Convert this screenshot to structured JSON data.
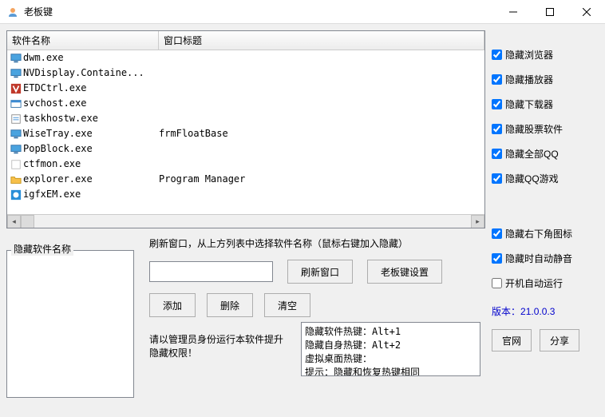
{
  "window": {
    "title": "老板键"
  },
  "table": {
    "headers": {
      "name": "软件名称",
      "title": "窗口标题"
    },
    "rows": [
      {
        "icon": "monitor",
        "name": "dwm.exe",
        "title": ""
      },
      {
        "icon": "monitor",
        "name": "NVDisplay.Containe...",
        "title": ""
      },
      {
        "icon": "etd",
        "name": "ETDCtrl.exe",
        "title": ""
      },
      {
        "icon": "svc",
        "name": "svchost.exe",
        "title": ""
      },
      {
        "icon": "task",
        "name": "taskhostw.exe",
        "title": ""
      },
      {
        "icon": "monitor",
        "name": "WiseTray.exe",
        "title": "frmFloatBase"
      },
      {
        "icon": "monitor",
        "name": "PopBlock.exe",
        "title": ""
      },
      {
        "icon": "blank",
        "name": "ctfmon.exe",
        "title": ""
      },
      {
        "icon": "folder",
        "name": "explorer.exe",
        "title": "Program Manager"
      },
      {
        "icon": "igfx",
        "name": "igfxEM.exe",
        "title": ""
      }
    ]
  },
  "hidelist": {
    "label": "隐藏软件名称"
  },
  "hint": "刷新窗口，从上方列表中选择软件名称（鼠标右键加入隐藏）",
  "buttons": {
    "add": "添加",
    "delete": "删除",
    "clear": "清空",
    "refresh": "刷新窗口",
    "settings": "老板键设置",
    "website": "官网",
    "share": "分享"
  },
  "hotkey_info": "隐藏软件热键：Alt+1\n隐藏自身热键：Alt+2\n虚拟桌面热键：\n提示：隐藏和恢复热键相同",
  "admin_note": "请以管理员身份运行本软件提升隐藏权限！",
  "checks": {
    "hide_browser": "隐藏浏览器",
    "hide_player": "隐藏播放器",
    "hide_downloader": "隐藏下载器",
    "hide_stock": "隐藏股票软件",
    "hide_all_qq": "隐藏全部QQ",
    "hide_qq_game": "隐藏QQ游戏",
    "hide_tray": "隐藏右下角图标",
    "auto_mute": "隐藏时自动静音",
    "auto_start": "开机自动运行"
  },
  "version_label": "版本：",
  "version": "21.0.0.3"
}
